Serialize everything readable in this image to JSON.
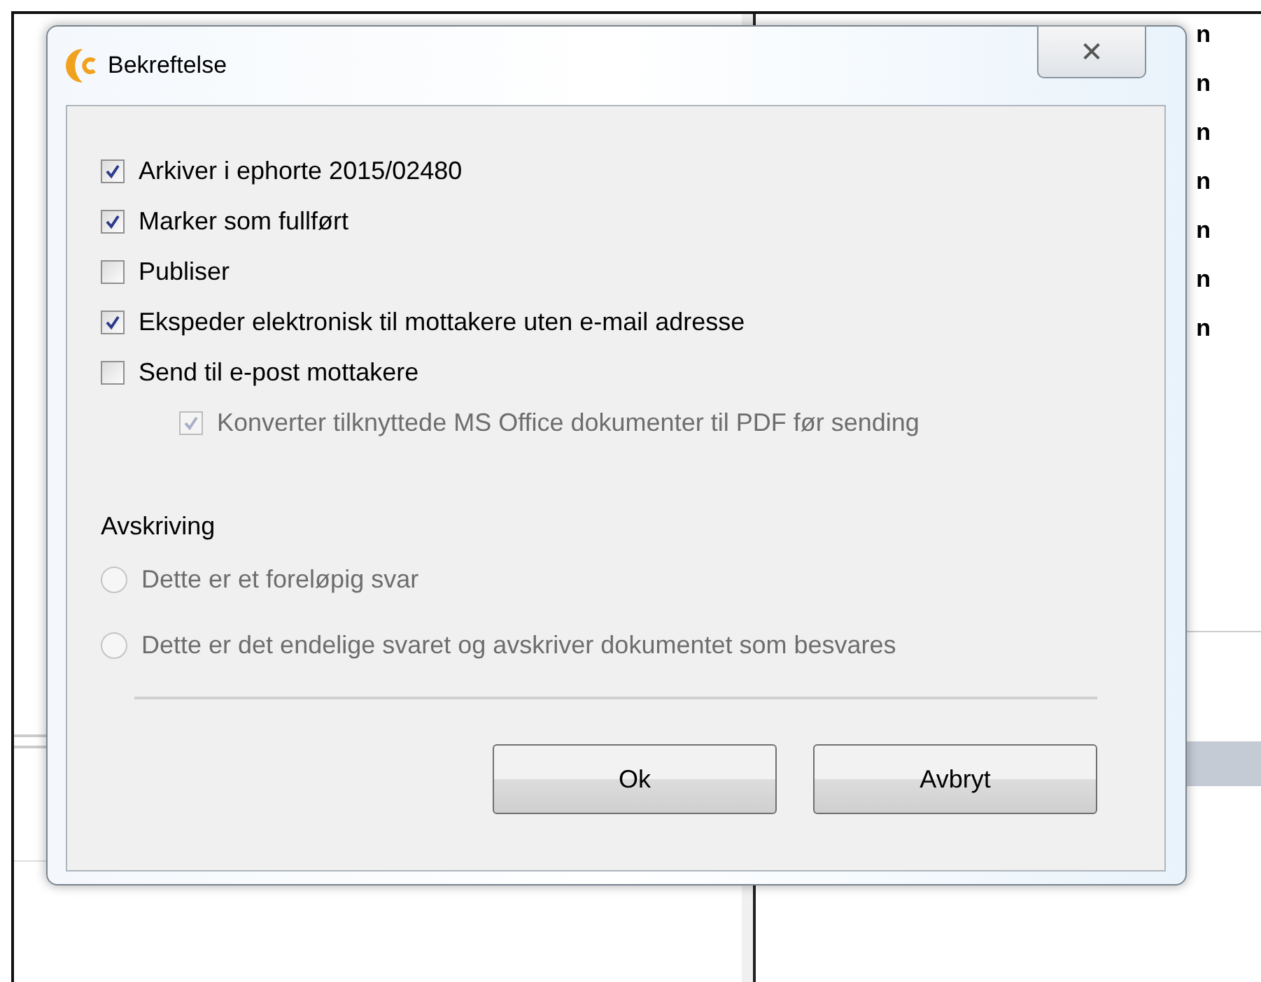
{
  "background_window": {
    "column_letters": [
      "n",
      "n",
      "n",
      "n",
      "n",
      "n",
      "n"
    ]
  },
  "dialog": {
    "title": "Bekreftelse",
    "close_label": "✕",
    "options": [
      {
        "label": "Arkiver i ephorte 2015/02480",
        "checked": true,
        "disabled": false
      },
      {
        "label": "Marker som fullført",
        "checked": true,
        "disabled": false
      },
      {
        "label": "Publiser",
        "checked": false,
        "disabled": false
      },
      {
        "label": "Ekspeder elektronisk til mottakere uten e-mail adresse",
        "checked": true,
        "disabled": false
      },
      {
        "label": "Send til e-post mottakere",
        "checked": false,
        "disabled": false,
        "children": [
          {
            "label": "Konverter tilknyttede MS Office dokumenter til PDF før sending",
            "checked": true,
            "disabled": true
          }
        ]
      }
    ],
    "group_label": "Avskriving",
    "radios": [
      {
        "label": "Dette er et foreløpig svar",
        "selected": false,
        "disabled": true
      },
      {
        "label": "Dette er det endelige svaret og avskriver dokumentet som besvares",
        "selected": false,
        "disabled": true
      }
    ],
    "buttons": [
      "Ok",
      "Avbryt"
    ]
  }
}
